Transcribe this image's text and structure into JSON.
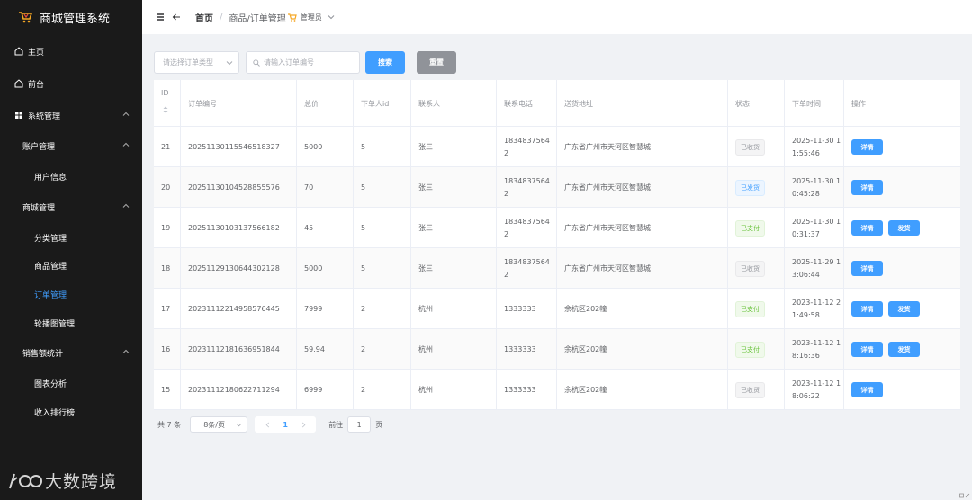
{
  "sidebar": {
    "brand_title": "商城管理系统",
    "home": "主页",
    "front": "前台",
    "system": "系统管理",
    "account_group": "账户管理",
    "user_info": "用户信息",
    "mall_group": "商城管理",
    "category": "分类管理",
    "product": "商品管理",
    "order": "订单管理",
    "carousel": "轮播图管理",
    "sales_group": "销售额统计",
    "chart_analysis": "图表分析",
    "revenue_rank": "收入排行榜",
    "watermark": "大数跨境"
  },
  "header": {
    "home": "首页",
    "separator": "/",
    "current": "商品/订单管理",
    "user": "管理员"
  },
  "filters": {
    "type_placeholder": "请选择订单类型",
    "order_no_placeholder": "请输入订单编号",
    "search_label": "搜索",
    "reset_label": "重置"
  },
  "table": {
    "columns": [
      "ID",
      "订单编号",
      "总价",
      "下单人id",
      "联系人",
      "联系电话",
      "送货地址",
      "状态",
      "下单时间",
      "操作"
    ],
    "rows": [
      {
        "id": "21",
        "order_no": "20251130115546518327",
        "total": "5000",
        "user_id": "5",
        "contact": "张三",
        "phone_1": "1834837564",
        "phone_2": "2",
        "address": "广东省广州市天河区智慧城",
        "status": "已收货",
        "status_type": "info",
        "time_1": "2025-11-30 1",
        "time_2": "1:55:46",
        "detail": "详情",
        "ship": ""
      },
      {
        "id": "20",
        "order_no": "20251130104528855576",
        "total": "70",
        "user_id": "5",
        "contact": "张三",
        "phone_1": "1834837564",
        "phone_2": "2",
        "address": "广东省广州市天河区智慧城",
        "status": "已发货",
        "status_type": "primary",
        "time_1": "2025-11-30 1",
        "time_2": "0:45:28",
        "detail": "详情",
        "ship": ""
      },
      {
        "id": "19",
        "order_no": "20251130103137566182",
        "total": "45",
        "user_id": "5",
        "contact": "张三",
        "phone_1": "1834837564",
        "phone_2": "2",
        "address": "广东省广州市天河区智慧城",
        "status": "已支付",
        "status_type": "success",
        "time_1": "2025-11-30 1",
        "time_2": "0:31:37",
        "detail": "详情",
        "ship": "发货"
      },
      {
        "id": "18",
        "order_no": "20251129130644302128",
        "total": "5000",
        "user_id": "5",
        "contact": "张三",
        "phone_1": "1834837564",
        "phone_2": "2",
        "address": "广东省广州市天河区智慧城",
        "status": "已收货",
        "status_type": "info",
        "time_1": "2025-11-29 1",
        "time_2": "3:06:44",
        "detail": "详情",
        "ship": ""
      },
      {
        "id": "17",
        "order_no": "20231112214958576445",
        "total": "7999",
        "user_id": "2",
        "contact": "杭州",
        "phone_1": "1333333",
        "phone_2": "",
        "address": "余杭区202幢",
        "status": "已支付",
        "status_type": "success",
        "time_1": "2023-11-12 2",
        "time_2": "1:49:58",
        "detail": "详情",
        "ship": "发货"
      },
      {
        "id": "16",
        "order_no": "20231112181636951844",
        "total": "59.94",
        "user_id": "2",
        "contact": "杭州",
        "phone_1": "1333333",
        "phone_2": "",
        "address": "余杭区202幢",
        "status": "已支付",
        "status_type": "success",
        "time_1": "2023-11-12 1",
        "time_2": "8:16:36",
        "detail": "详情",
        "ship": "发货"
      },
      {
        "id": "15",
        "order_no": "20231112180622711294",
        "total": "6999",
        "user_id": "2",
        "contact": "杭州",
        "phone_1": "1333333",
        "phone_2": "",
        "address": "余杭区202幢",
        "status": "已收货",
        "status_type": "info",
        "time_1": "2023-11-12 1",
        "time_2": "8:06:22",
        "detail": "详情",
        "ship": ""
      }
    ]
  },
  "pagination": {
    "total": "共 7 条",
    "page_size": "8条/页",
    "current_page": "1",
    "goto_label": "前往",
    "goto_value": "1",
    "page_suffix": "页"
  }
}
